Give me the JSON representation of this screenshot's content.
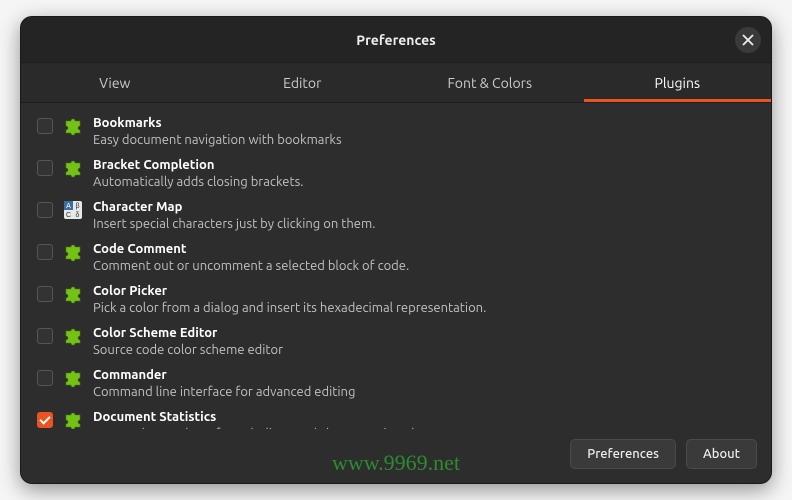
{
  "title": "Preferences",
  "tabs": [
    {
      "label": "View",
      "active": false
    },
    {
      "label": "Editor",
      "active": false
    },
    {
      "label": "Font & Colors",
      "active": false
    },
    {
      "label": "Plugins",
      "active": true
    }
  ],
  "plugins": [
    {
      "name": "Bookmarks",
      "desc": "Easy document navigation with bookmarks",
      "checked": false,
      "icon": "puzzle"
    },
    {
      "name": "Bracket Completion",
      "desc": "Automatically adds closing brackets.",
      "checked": false,
      "icon": "puzzle"
    },
    {
      "name": "Character Map",
      "desc": "Insert special characters just by clicking on them.",
      "checked": false,
      "icon": "charmap"
    },
    {
      "name": "Code Comment",
      "desc": "Comment out or uncomment a selected block of code.",
      "checked": false,
      "icon": "puzzle"
    },
    {
      "name": "Color Picker",
      "desc": "Pick a color from a dialog and insert its hexadecimal representation.",
      "checked": false,
      "icon": "puzzle"
    },
    {
      "name": "Color Scheme Editor",
      "desc": "Source code color scheme editor",
      "checked": false,
      "icon": "puzzle"
    },
    {
      "name": "Commander",
      "desc": "Command line interface for advanced editing",
      "checked": false,
      "icon": "puzzle"
    },
    {
      "name": "Document Statistics",
      "desc": "Report the number of words, lines and characters in a document.",
      "checked": true,
      "icon": "puzzle"
    }
  ],
  "buttons": {
    "preferences": "Preferences",
    "about": "About"
  },
  "watermark": "www.9969.net"
}
